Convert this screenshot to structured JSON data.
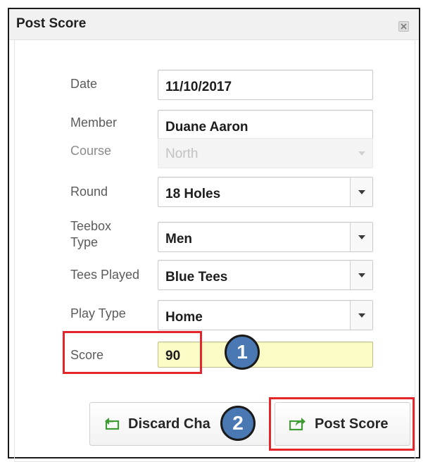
{
  "dialog": {
    "title": "Post Score",
    "close_icon": "close-icon"
  },
  "form": {
    "date": {
      "label": "Date",
      "value": "11/10/2017"
    },
    "member": {
      "label": "Member",
      "value": "Duane Aaron"
    },
    "course": {
      "label": "Course",
      "value": "North",
      "disabled": true
    },
    "round": {
      "label": "Round",
      "value": "18 Holes"
    },
    "teebox_type": {
      "label_line1": "Teebox",
      "label_line2": "Type",
      "value": "Men"
    },
    "tees_played": {
      "label": "Tees Played",
      "value": "Blue Tees"
    },
    "play_type": {
      "label": "Play Type",
      "value": "Home"
    },
    "score": {
      "label": "Score",
      "value": "90"
    }
  },
  "buttons": {
    "discard_label": "Discard Cha",
    "discard_icon": "undo-icon",
    "post_label": "Post Score",
    "post_icon": "share-icon"
  },
  "annotations": {
    "step1": "1",
    "step2": "2",
    "highlight_color": "#e2262c",
    "badge_color": "#4a78b3"
  },
  "colors": {
    "score_field_bg": "#fbfbc6",
    "icon_green": "#3f9c35"
  }
}
